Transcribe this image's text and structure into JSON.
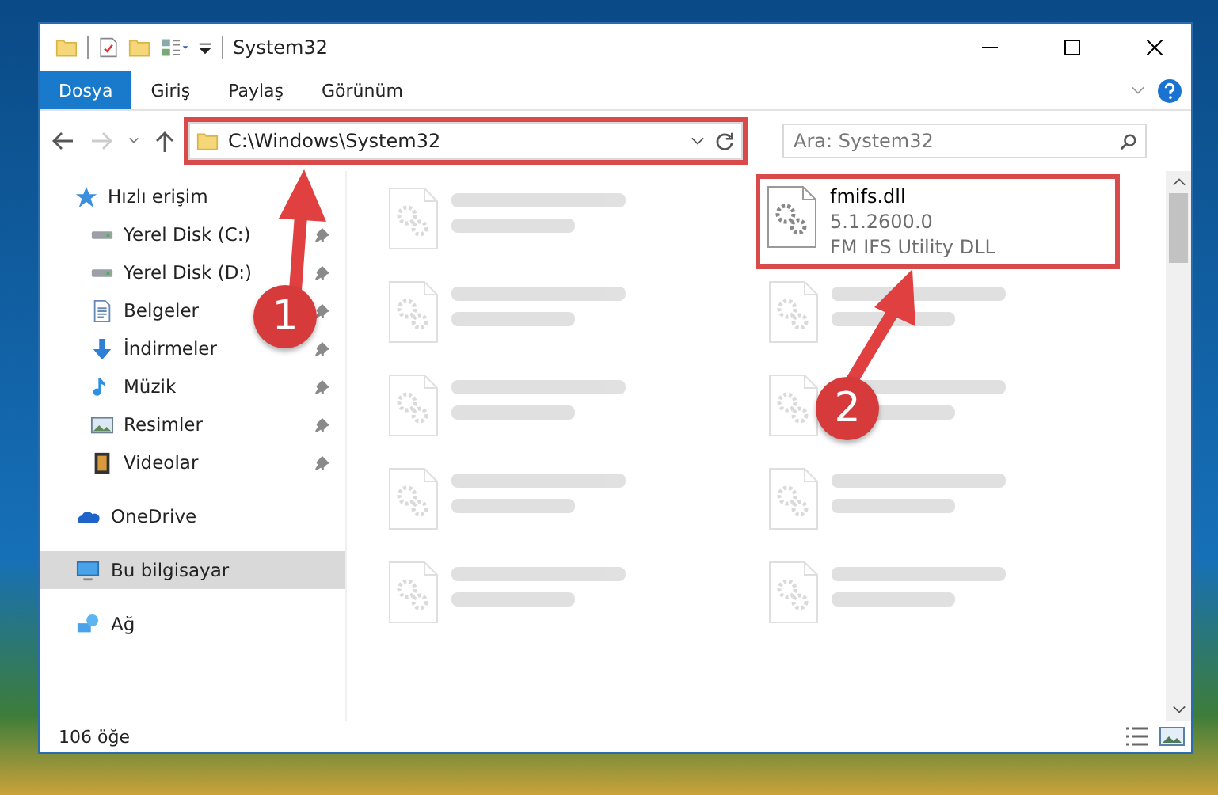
{
  "window": {
    "title": "System32"
  },
  "ribbon_tabs": [
    {
      "label": "Dosya",
      "selected": true
    },
    {
      "label": "Giriş",
      "selected": false
    },
    {
      "label": "Paylaş",
      "selected": false
    },
    {
      "label": "Görünüm",
      "selected": false
    }
  ],
  "address_bar": {
    "value": "C:\\Windows\\System32",
    "highlighted": true
  },
  "search": {
    "placeholder": "Ara: System32"
  },
  "sidebar": {
    "items": [
      {
        "label": "Hızlı erişim",
        "kind": "star",
        "selected": false,
        "children": [
          {
            "label": "Yerel Disk (C:)",
            "kind": "drive",
            "pinned": true,
            "selected": false
          },
          {
            "label": "Yerel Disk (D:)",
            "kind": "drive",
            "pinned": true,
            "selected": false
          },
          {
            "label": "Belgeler",
            "kind": "document",
            "pinned": true,
            "selected": false
          },
          {
            "label": "İndirmeler",
            "kind": "download",
            "pinned": true,
            "selected": false
          },
          {
            "label": "Müzik",
            "kind": "music",
            "pinned": true,
            "selected": false
          },
          {
            "label": "Resimler",
            "kind": "picture",
            "pinned": true,
            "selected": false
          },
          {
            "label": "Videolar",
            "kind": "video",
            "pinned": true,
            "selected": false
          }
        ]
      },
      {
        "label": "OneDrive",
        "kind": "cloud",
        "selected": false
      },
      {
        "label": "Bu bilgisayar",
        "kind": "computer",
        "selected": true
      },
      {
        "label": "Ağ",
        "kind": "network",
        "selected": false
      }
    ]
  },
  "files": [
    {
      "kind": "blurred"
    },
    {
      "kind": "file",
      "name": "fmifs.dll",
      "version": "5.1.2600.0",
      "description": "FM IFS Utility DLL",
      "highlighted": true
    },
    {
      "kind": "blurred"
    },
    {
      "kind": "blurred"
    },
    {
      "kind": "blurred"
    },
    {
      "kind": "blurred"
    },
    {
      "kind": "blurred"
    },
    {
      "kind": "blurred"
    },
    {
      "kind": "blurred"
    },
    {
      "kind": "blurred"
    }
  ],
  "status_bar": {
    "item_count": "106 öğe"
  },
  "annotations": [
    {
      "label": "1"
    },
    {
      "label": "2"
    }
  ]
}
